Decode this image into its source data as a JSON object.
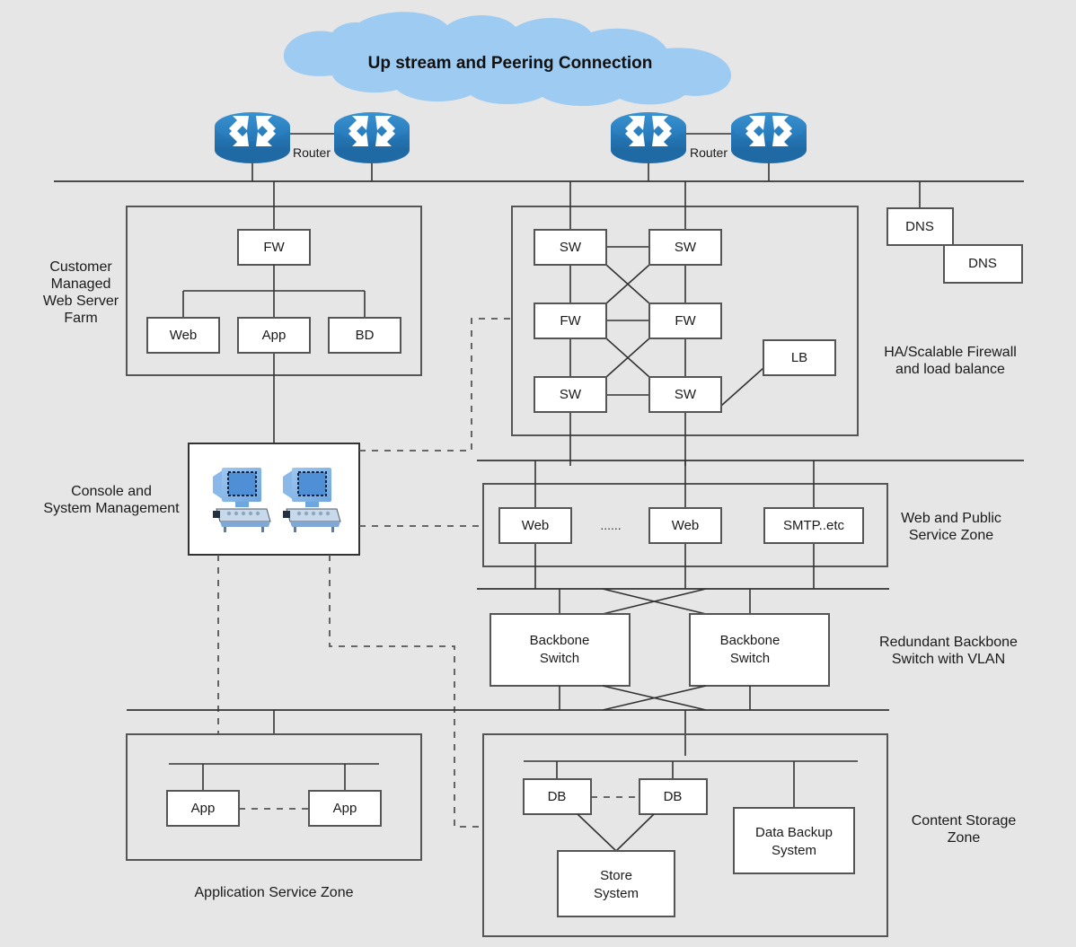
{
  "cloud": {
    "title": "Up stream and Peering Connection",
    "color": "#9ecbf2"
  },
  "routers": {
    "label_left": "Router",
    "label_right": "Router",
    "color": "#2a7fc0",
    "count": 4,
    "icon": "router-arrows-icon"
  },
  "zones": {
    "web_server_farm": {
      "label": "Customer\nManaged\nWeb Server\nFarm",
      "label_lines": [
        "Customer",
        "Managed",
        "Web Server",
        "Farm"
      ],
      "nodes": [
        {
          "id": "fw",
          "label": "FW"
        },
        {
          "id": "web",
          "label": "Web"
        },
        {
          "id": "app",
          "label": "App"
        },
        {
          "id": "bd",
          "label": "BD"
        }
      ]
    },
    "ha_firewall": {
      "label_lines": [
        "HA/Scalable Firewall",
        "and load balance"
      ],
      "nodes": [
        {
          "id": "sw-tl",
          "label": "SW"
        },
        {
          "id": "sw-tr",
          "label": "SW"
        },
        {
          "id": "fw-l",
          "label": "FW"
        },
        {
          "id": "fw-r",
          "label": "FW"
        },
        {
          "id": "sw-bl",
          "label": "SW"
        },
        {
          "id": "sw-br",
          "label": "SW"
        },
        {
          "id": "lb",
          "label": "LB"
        }
      ]
    },
    "dns": {
      "nodes": [
        {
          "id": "dns-1",
          "label": "DNS"
        },
        {
          "id": "dns-2",
          "label": "DNS"
        }
      ]
    },
    "console": {
      "label_lines": [
        "Console and",
        "System Management"
      ],
      "icons": [
        "workstation-icon",
        "workstation-icon"
      ]
    },
    "web_public": {
      "label_lines": [
        "Web and Public",
        "Service Zone"
      ],
      "nodes": [
        {
          "id": "web-1",
          "label": "Web"
        },
        {
          "id": "ellipsis",
          "label": "......"
        },
        {
          "id": "web-2",
          "label": "Web"
        },
        {
          "id": "smtp",
          "label": "SMTP..etc"
        }
      ]
    },
    "backbone": {
      "label_lines": [
        "Redundant Backbone",
        "Switch with VLAN"
      ],
      "nodes": [
        {
          "id": "bb-1",
          "label_lines": [
            "Backbone",
            "Switch"
          ]
        },
        {
          "id": "bb-2",
          "label_lines": [
            "Backbone",
            "Switch"
          ]
        }
      ]
    },
    "application": {
      "label": "Application Service Zone",
      "nodes": [
        {
          "id": "app-1",
          "label": "App"
        },
        {
          "id": "app-2",
          "label": "App"
        }
      ]
    },
    "content_storage": {
      "label_lines": [
        "Content Storage",
        "Zone"
      ],
      "nodes": [
        {
          "id": "db-1",
          "label": "DB"
        },
        {
          "id": "db-2",
          "label": "DB"
        },
        {
          "id": "store",
          "label_lines": [
            "Store",
            "System"
          ]
        },
        {
          "id": "backup",
          "label_lines": [
            "Data Backup",
            "System"
          ]
        }
      ]
    }
  },
  "colors": {
    "background": "#e6e6e6",
    "node_fill": "#ffffff",
    "stroke": "#555555",
    "line": "#333333",
    "router_blue": "#2a7fc0",
    "cloud_blue": "#9ecbf2",
    "monitor_blue": "#7fb2e5"
  },
  "text": {
    "cloud_title": "Up stream and Peering Connection",
    "router_left": "Router",
    "router_right": "Router",
    "farm_l1": "Customer",
    "farm_l2": "Managed",
    "farm_l3": "Web Server",
    "farm_l4": "Farm",
    "fw": "FW",
    "web": "Web",
    "app": "App",
    "bd": "BD",
    "sw": "SW",
    "lb": "LB",
    "dns": "DNS",
    "ha_l1": "HA/Scalable Firewall",
    "ha_l2": "and load balance",
    "console_l1": "Console and",
    "console_l2": "System Management",
    "webpub_l1": "Web and Public",
    "webpub_l2": "Service Zone",
    "smtp": "SMTP..etc",
    "ellipsis": "......",
    "backbone_l1": "Backbone",
    "backbone_l2": "Switch",
    "backbone_r1": "Redundant Backbone",
    "backbone_r2": "Switch with VLAN",
    "appzone": "Application Service Zone",
    "db": "DB",
    "store_l1": "Store",
    "store_l2": "System",
    "backup_l1": "Data Backup",
    "backup_l2": "System",
    "content_l1": "Content Storage",
    "content_l2": "Zone"
  }
}
